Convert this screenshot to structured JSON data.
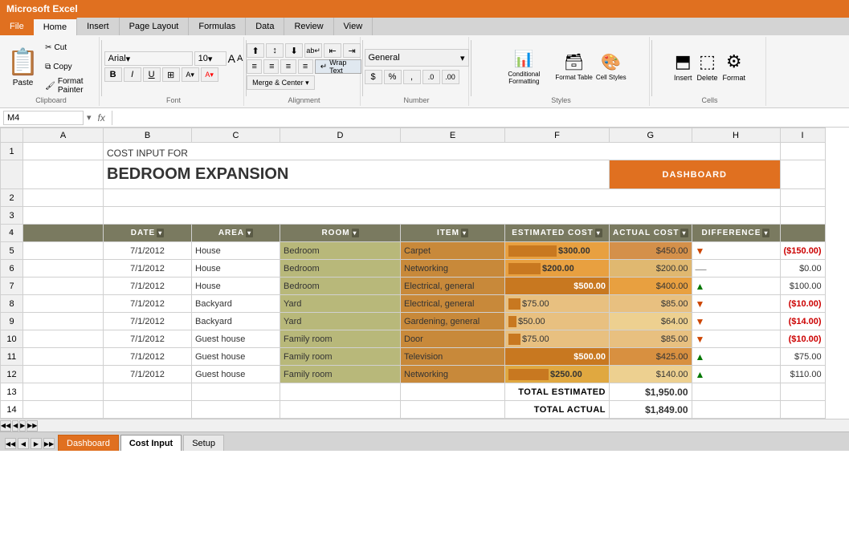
{
  "app": {
    "title": "Microsoft Excel",
    "file_menu": "File"
  },
  "ribbon": {
    "tabs": [
      "File",
      "Home",
      "Insert",
      "Page Layout",
      "Formulas",
      "Data",
      "Review",
      "View"
    ],
    "active_tab": "Home",
    "groups": {
      "clipboard": {
        "label": "Clipboard",
        "paste_label": "Paste",
        "cut_label": "Cut",
        "copy_label": "Copy",
        "format_painter_label": "Format Painter"
      },
      "font": {
        "label": "Font",
        "font_name": "Arial",
        "font_size": "10",
        "bold": "B",
        "italic": "I",
        "underline": "U"
      },
      "alignment": {
        "label": "Alignment",
        "wrap_text": "Wrap Text",
        "merge_center": "Merge & Center ▾"
      },
      "number": {
        "label": "Number",
        "format": "General"
      },
      "styles": {
        "label": "Styles",
        "conditional_formatting": "Conditional Formatting",
        "format_table": "Format Table",
        "cell_styles": "Cell Styles"
      },
      "cells": {
        "label": "Cells",
        "insert": "Insert",
        "delete": "Delete",
        "format": "Format"
      }
    }
  },
  "formula_bar": {
    "cell_ref": "M4",
    "fx": "fx",
    "formula": ""
  },
  "spreadsheet": {
    "title_line1": "COST INPUT FOR",
    "title_line2": "BEDROOM EXPANSION",
    "dashboard_btn": "DASHBOARD",
    "columns": {
      "headers": [
        "DATE",
        "AREA",
        "ROOM",
        "ITEM",
        "ESTIMATED COST",
        "ACTUAL COST",
        "DIFFERENCE"
      ]
    },
    "rows": [
      {
        "row_num": "5",
        "date": "7/1/2012",
        "area": "House",
        "room": "Bedroom",
        "item": "Carpet",
        "estimated": "$300.00",
        "actual": "$450.00",
        "arrow": "down",
        "diff": "($150.00)",
        "diff_type": "negative",
        "est_bar": 60,
        "act_bar": 90
      },
      {
        "row_num": "6",
        "date": "7/1/2012",
        "area": "House",
        "room": "Bedroom",
        "item": "Networking",
        "estimated": "$200.00",
        "actual": "$200.00",
        "arrow": "equal",
        "diff": "$0.00",
        "diff_type": "zero",
        "est_bar": 40,
        "act_bar": 40
      },
      {
        "row_num": "7",
        "date": "7/1/2012",
        "area": "House",
        "room": "Bedroom",
        "item": "Electrical, general",
        "estimated": "$500.00",
        "actual": "$400.00",
        "arrow": "up",
        "diff": "$100.00",
        "diff_type": "positive",
        "est_bar": 100,
        "act_bar": 80
      },
      {
        "row_num": "8",
        "date": "7/1/2012",
        "area": "Backyard",
        "room": "Yard",
        "item": "Electrical, general",
        "estimated": "$75.00",
        "actual": "$85.00",
        "arrow": "down",
        "diff": "($10.00)",
        "diff_type": "negative",
        "est_bar": 15,
        "act_bar": 17
      },
      {
        "row_num": "9",
        "date": "7/1/2012",
        "area": "Backyard",
        "room": "Yard",
        "item": "Gardening, general",
        "estimated": "$50.00",
        "actual": "$64.00",
        "arrow": "down",
        "diff": "($14.00)",
        "diff_type": "negative",
        "est_bar": 10,
        "act_bar": 13
      },
      {
        "row_num": "10",
        "date": "7/1/2012",
        "area": "Guest house",
        "room": "Family room",
        "item": "Door",
        "estimated": "$75.00",
        "actual": "$85.00",
        "arrow": "down",
        "diff": "($10.00)",
        "diff_type": "negative",
        "est_bar": 15,
        "act_bar": 17
      },
      {
        "row_num": "11",
        "date": "7/1/2012",
        "area": "Guest house",
        "room": "Family room",
        "item": "Television",
        "estimated": "$500.00",
        "actual": "$425.00",
        "arrow": "up",
        "diff": "$75.00",
        "diff_type": "positive",
        "est_bar": 100,
        "act_bar": 85
      },
      {
        "row_num": "12",
        "date": "7/1/2012",
        "area": "Guest house",
        "room": "Family room",
        "item": "Networking",
        "estimated": "$250.00",
        "actual": "$140.00",
        "arrow": "up",
        "diff": "$110.00",
        "diff_type": "positive",
        "est_bar": 50,
        "act_bar": 28
      }
    ],
    "totals": {
      "estimated_label": "TOTAL ESTIMATED",
      "estimated_value": "$1,950.00",
      "actual_label": "TOTAL ACTUAL",
      "actual_value": "$1,849.00"
    }
  },
  "sheet_tabs": [
    "Dashboard",
    "Cost Input",
    "Setup"
  ]
}
